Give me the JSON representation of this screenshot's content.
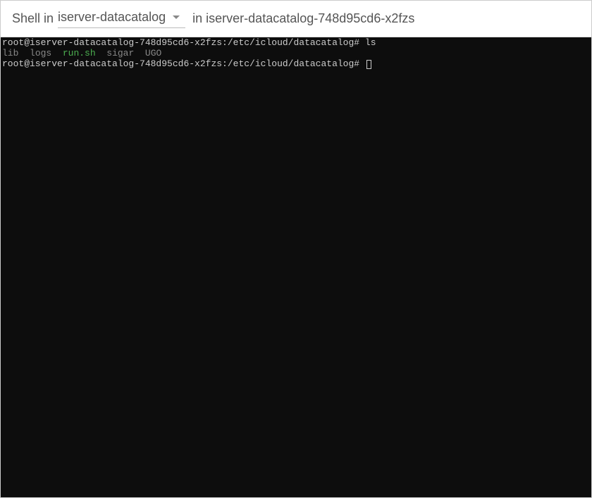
{
  "header": {
    "shellLabel": "Shell in",
    "dropdownValue": "iserver-datacatalog",
    "podPrefix": "in",
    "podName": "iserver-datacatalog-748d95cd6-x2fzs"
  },
  "terminal": {
    "prompt": "root@iserver-datacatalog-748d95cd6-x2fzs:/etc/icloud/datacatalog#",
    "cmd1": "ls",
    "lsItems": {
      "lib": "lib",
      "logs": "logs",
      "runsh": "run.sh",
      "sigar": "sigar",
      "ugo": "UGO"
    }
  }
}
